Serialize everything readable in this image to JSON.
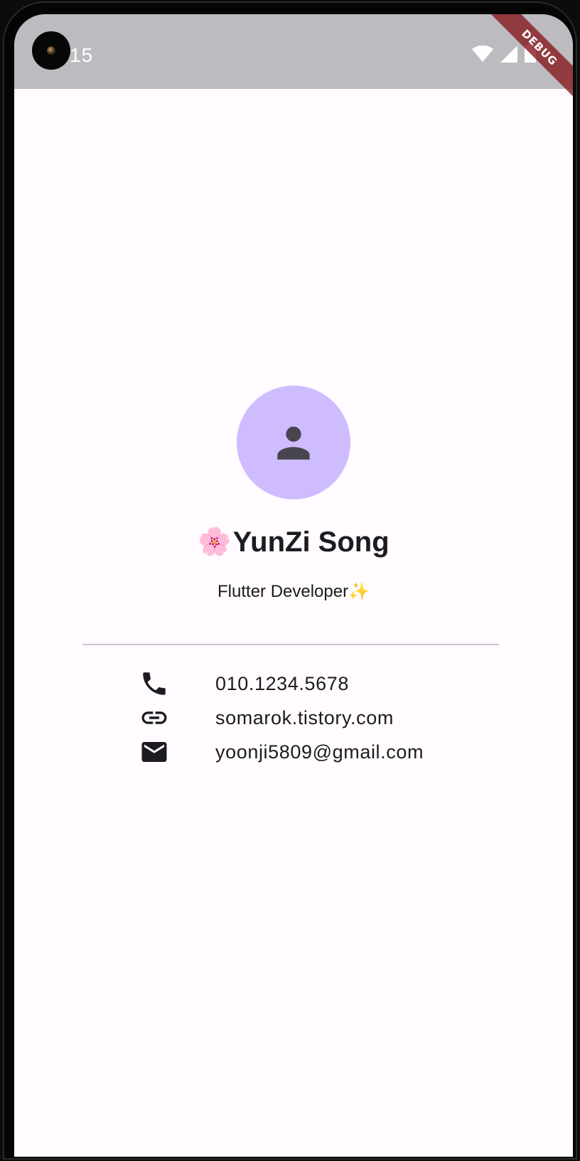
{
  "status_bar": {
    "time": "15",
    "icons": [
      "camera-cutout",
      "wifi-icon",
      "cellular-signal-icon",
      "battery-icon"
    ],
    "debug_banner": "DEBUG"
  },
  "profile": {
    "avatar_icon": "person-icon",
    "name_prefix_emoji": "🌸",
    "name": "YunZi Song",
    "role": "Flutter Developer",
    "role_suffix_emoji": "✨"
  },
  "contacts": [
    {
      "icon": "phone-icon",
      "text": "010.1234.5678"
    },
    {
      "icon": "link-icon",
      "text": "somarok.tistory.com"
    },
    {
      "icon": "email-icon",
      "text": "yoonji5809@gmail.com"
    }
  ],
  "colors": {
    "status_bar_bg": "#bdbbbf",
    "screen_bg": "#fffbff",
    "avatar_bg": "#cfbcff",
    "avatar_icon": "#49454f",
    "text": "#1c1b1f",
    "divider": "#cac4d0",
    "debug_banner": "#881e24"
  }
}
